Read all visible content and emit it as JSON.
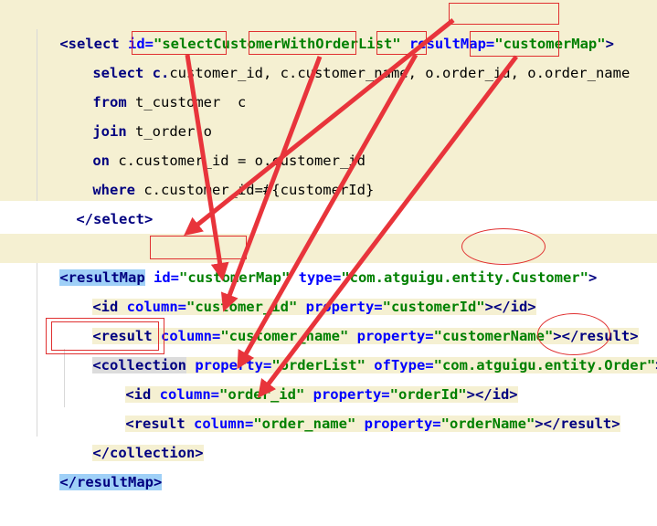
{
  "colors": {
    "tag": "#000080",
    "attribute": "#0000ff",
    "string": "#008000",
    "highlight_band": "#f5f0d2",
    "tag_highlight": "#9fd0f7",
    "annotation": "#e03030"
  },
  "code": {
    "l1": {
      "open": "<select",
      "a1": " id=",
      "v1": "\"selectCustomerWithOrderList\"",
      "a2": " resultMap=",
      "v2": "\"customerMap\"",
      "close": ">"
    },
    "l2": {
      "kw": "select ",
      "t1": "c.",
      "t2": "customer_id",
      "t3": ", c.",
      "t4": "customer_name",
      "t5": ", o.",
      "t6": "order_id",
      "t7": ", o.",
      "t8": "order_name"
    },
    "l3": {
      "kw": "from ",
      "t1": "t_customer  c"
    },
    "l4": {
      "kw": "join ",
      "t1": "t_order o"
    },
    "l5": {
      "kw": "on ",
      "t1": "c.customer_id = o.customer_id"
    },
    "l6": {
      "kw": "where ",
      "t1": "c.customer_id=#{customerId}"
    },
    "l7": {
      "tag": "</select>"
    },
    "l8": {
      "open": "<resultMap",
      "a1": " id=",
      "v1": "\"customerMap\"",
      "a2": " type=",
      "v2": "\"com.atguigu.entity.Customer\"",
      "close": ">"
    },
    "l9": {
      "open": "<id",
      "a1": " column=",
      "v1": "\"customer_id\"",
      "a2": " property=",
      "v2": "\"customerId\"",
      "close": "></id>"
    },
    "l10": {
      "open": "<result",
      "a1": " column=",
      "v1": "\"customer_name\"",
      "a2": " property=",
      "v2": "\"customerName\"",
      "close": "></result>"
    },
    "l11": {
      "open": "<collection",
      "a1": " property=",
      "v1": "\"orderList\"",
      "a2": " ofType=",
      "v2": "\"com.atguigu.entity.Order\"",
      "close": ">"
    },
    "l12": {
      "open": "<id",
      "a1": " column=",
      "v1": "\"order_id\"",
      "a2": " property=",
      "v2": "\"orderId\"",
      "close": "></id>"
    },
    "l13": {
      "open": "<result",
      "a1": " column=",
      "v1": "\"order_name\"",
      "a2": " property=",
      "v2": "\"orderName\"",
      "close": "></result>"
    },
    "l14": {
      "tag": "</collection>"
    },
    "l15": {
      "tag": "</resultMap>"
    }
  }
}
